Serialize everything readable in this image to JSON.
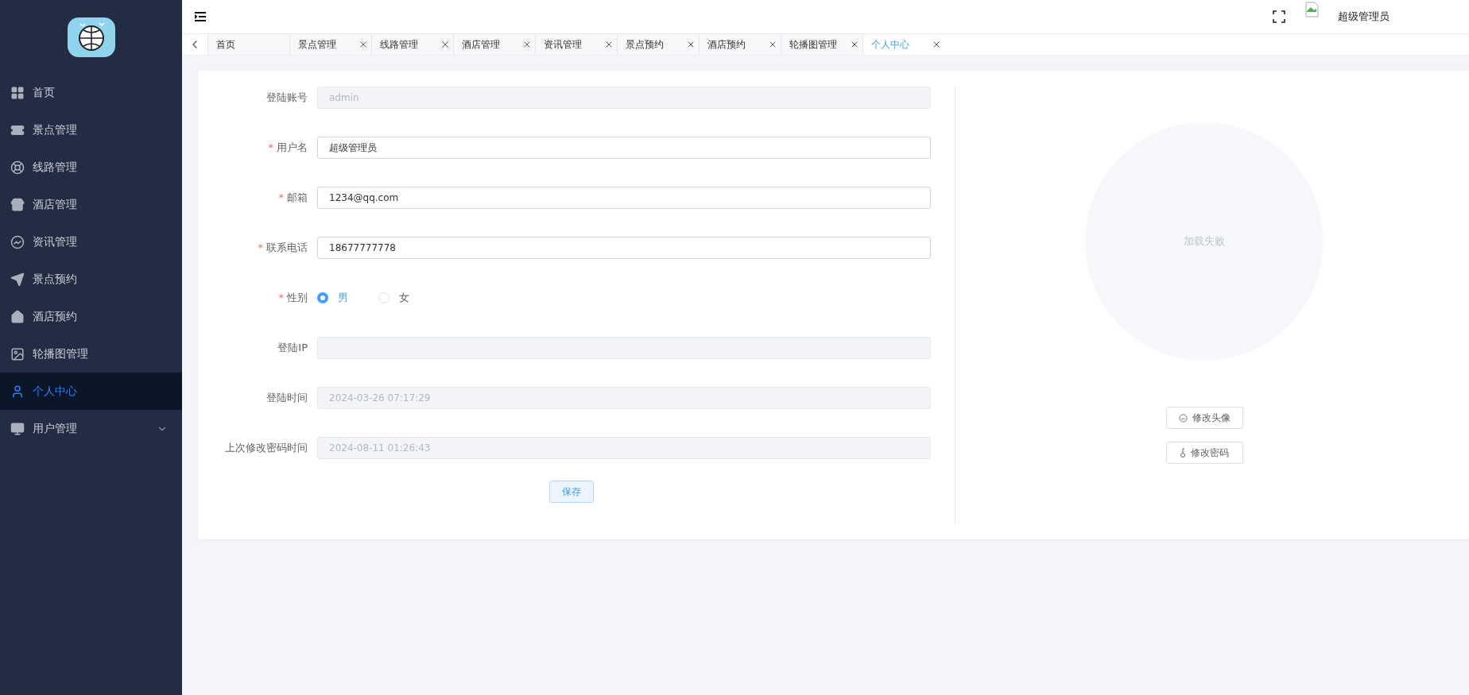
{
  "sidebar": {
    "items": [
      {
        "label": "首页",
        "kind": "link",
        "selected": false
      },
      {
        "label": "景点管理",
        "kind": "link",
        "selected": false
      },
      {
        "label": "线路管理",
        "kind": "link",
        "selected": false
      },
      {
        "label": "酒店管理",
        "kind": "link",
        "selected": false
      },
      {
        "label": "资讯管理",
        "kind": "link",
        "selected": false
      },
      {
        "label": "景点预约",
        "kind": "link",
        "selected": false
      },
      {
        "label": "酒店预约",
        "kind": "link",
        "selected": false
      },
      {
        "label": "轮播图管理",
        "kind": "link",
        "selected": false
      },
      {
        "label": "个人中心",
        "kind": "link",
        "selected": true
      },
      {
        "label": "用户管理",
        "kind": "submenu",
        "selected": false,
        "expanded": false
      }
    ]
  },
  "header": {
    "user_name": "超级管理员"
  },
  "tabs": [
    {
      "label": "首页",
      "selected": false,
      "closable": false
    },
    {
      "label": "景点管理",
      "selected": false,
      "closable": true
    },
    {
      "label": "线路管理",
      "selected": false,
      "closable": true
    },
    {
      "label": "酒店管理",
      "selected": false,
      "closable": true
    },
    {
      "label": "资讯管理",
      "selected": false,
      "closable": true
    },
    {
      "label": "景点预约",
      "selected": false,
      "closable": true
    },
    {
      "label": "酒店预约",
      "selected": false,
      "closable": true
    },
    {
      "label": "轮播图管理",
      "selected": false,
      "closable": true
    },
    {
      "label": "个人中心",
      "selected": true,
      "closable": true
    }
  ],
  "form": {
    "required_mark": "*",
    "fields": [
      {
        "label": "登陆账号",
        "kind": "input",
        "required": false,
        "disabled": true,
        "value": "admin"
      },
      {
        "label": "用户名",
        "kind": "input",
        "required": true,
        "disabled": false,
        "value": "超级管理员"
      },
      {
        "label": "邮箱",
        "kind": "input",
        "required": true,
        "disabled": false,
        "value": "1234@qq.com"
      },
      {
        "label": "联系电话",
        "kind": "input",
        "required": true,
        "disabled": false,
        "value": "18677777778"
      },
      {
        "label": "性别",
        "kind": "radio",
        "required": true,
        "options": [
          {
            "label": "男",
            "selected": true
          },
          {
            "label": "女",
            "selected": false
          }
        ]
      },
      {
        "label": "登陆IP",
        "kind": "input",
        "required": false,
        "disabled": true
      },
      {
        "label": "登陆时间",
        "kind": "input",
        "required": false,
        "disabled": true,
        "value": "2024-03-26 07:17:29"
      },
      {
        "label": "上次修改密码时间",
        "kind": "input",
        "required": false,
        "disabled": true,
        "value": "2024-08-11 01:26:43"
      }
    ],
    "save_button": "保存"
  },
  "avatar_panel": {
    "status": "加载失败",
    "buttons": [
      "修改头像",
      "修改密码"
    ]
  }
}
